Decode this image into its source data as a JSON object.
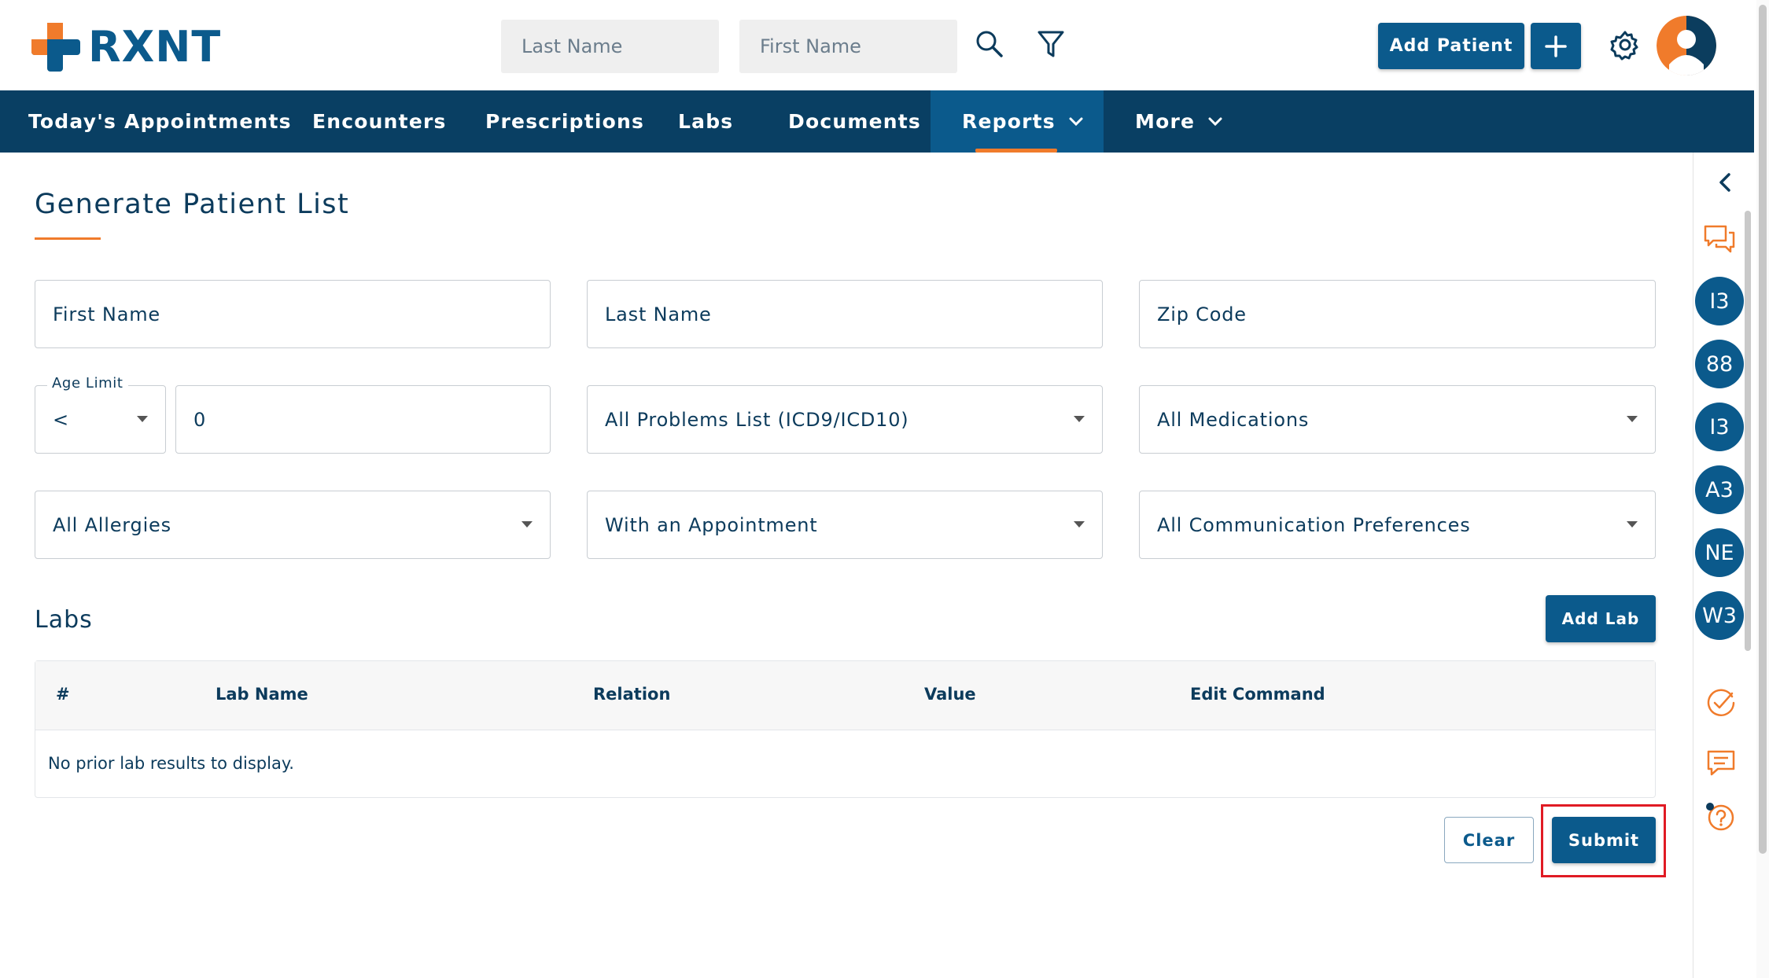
{
  "brand": {
    "name": "RXNT",
    "accent": "#f07b2b",
    "primary": "#0b5a8c",
    "nav_bg": "#093f63"
  },
  "header": {
    "last_name_placeholder": "Last Name",
    "first_name_placeholder": "First Name",
    "add_patient_label": "Add Patient",
    "add_icon": "plus-icon",
    "search_icon": "search-icon",
    "filter_icon": "filter-icon",
    "settings_icon": "gear-icon"
  },
  "nav": {
    "items": [
      {
        "label": "Today's Appointments"
      },
      {
        "label": "Encounters"
      },
      {
        "label": "Prescriptions"
      },
      {
        "label": "Labs"
      },
      {
        "label": "Documents"
      },
      {
        "label": "Reports",
        "active": true
      },
      {
        "label": "More"
      }
    ]
  },
  "page": {
    "title": "Generate Patient List",
    "fields": {
      "first_name": "First Name",
      "last_name": "Last Name",
      "zip_code": "Zip Code",
      "age_limit_label": "Age Limit",
      "age_operator": "<",
      "age_value": "0",
      "problems": "All Problems List (ICD9/ICD10)",
      "medications": "All Medications",
      "allergies": "All Allergies",
      "appointment": "With an Appointment",
      "communication": "All Communication Preferences"
    },
    "labs": {
      "title": "Labs",
      "add_lab_label": "Add Lab",
      "columns": [
        "#",
        "Lab Name",
        "Relation",
        "Value",
        "Edit Command"
      ],
      "empty_message": "No prior lab results to display."
    },
    "actions": {
      "clear_label": "Clear",
      "submit_label": "Submit"
    }
  },
  "rail": {
    "badges": [
      "I3",
      "88",
      "I3",
      "A3",
      "NE",
      "W3"
    ],
    "icons": [
      "chevron-left-icon",
      "chat-bubbles-icon",
      "check-circle-icon",
      "message-icon",
      "help-icon"
    ]
  }
}
